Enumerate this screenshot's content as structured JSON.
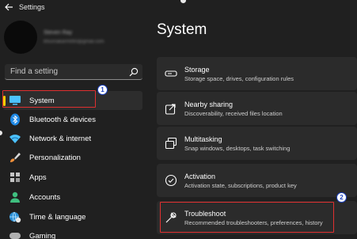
{
  "app": {
    "title": "Settings"
  },
  "profile": {
    "name": "Steven Ray",
    "email": "bhuvnakarm990@gmail.com"
  },
  "search": {
    "placeholder": "Find a setting"
  },
  "sidebar": {
    "items": [
      {
        "label": "System",
        "icon": "monitor-icon",
        "selected": true
      },
      {
        "label": "Bluetooth & devices",
        "icon": "bluetooth-icon"
      },
      {
        "label": "Network & internet",
        "icon": "wifi-icon"
      },
      {
        "label": "Personalization",
        "icon": "brush-icon"
      },
      {
        "label": "Apps",
        "icon": "apps-icon"
      },
      {
        "label": "Accounts",
        "icon": "person-icon"
      },
      {
        "label": "Time & language",
        "icon": "globe-clock-icon"
      },
      {
        "label": "Gaming",
        "icon": "gamepad-icon"
      }
    ]
  },
  "main": {
    "title": "System",
    "cards": [
      {
        "title": "Storage",
        "desc": "Storage space, drives, configuration rules",
        "icon": "storage-icon"
      },
      {
        "title": "Nearby sharing",
        "desc": "Discoverability, received files location",
        "icon": "share-icon"
      },
      {
        "title": "Multitasking",
        "desc": "Snap windows, desktops, task switching",
        "icon": "multitasking-icon"
      },
      {
        "title": "Activation",
        "desc": "Activation state, subscriptions, product key",
        "icon": "check-circle-icon"
      },
      {
        "title": "Troubleshoot",
        "desc": "Recommended troubleshooters, preferences, history",
        "icon": "wrench-icon"
      }
    ]
  },
  "annotations": {
    "step1": "1",
    "step2": "2"
  },
  "colors": {
    "highlight": "#e03030",
    "badge_border": "#1a40c0",
    "selection_bar": "#ffcc00"
  }
}
